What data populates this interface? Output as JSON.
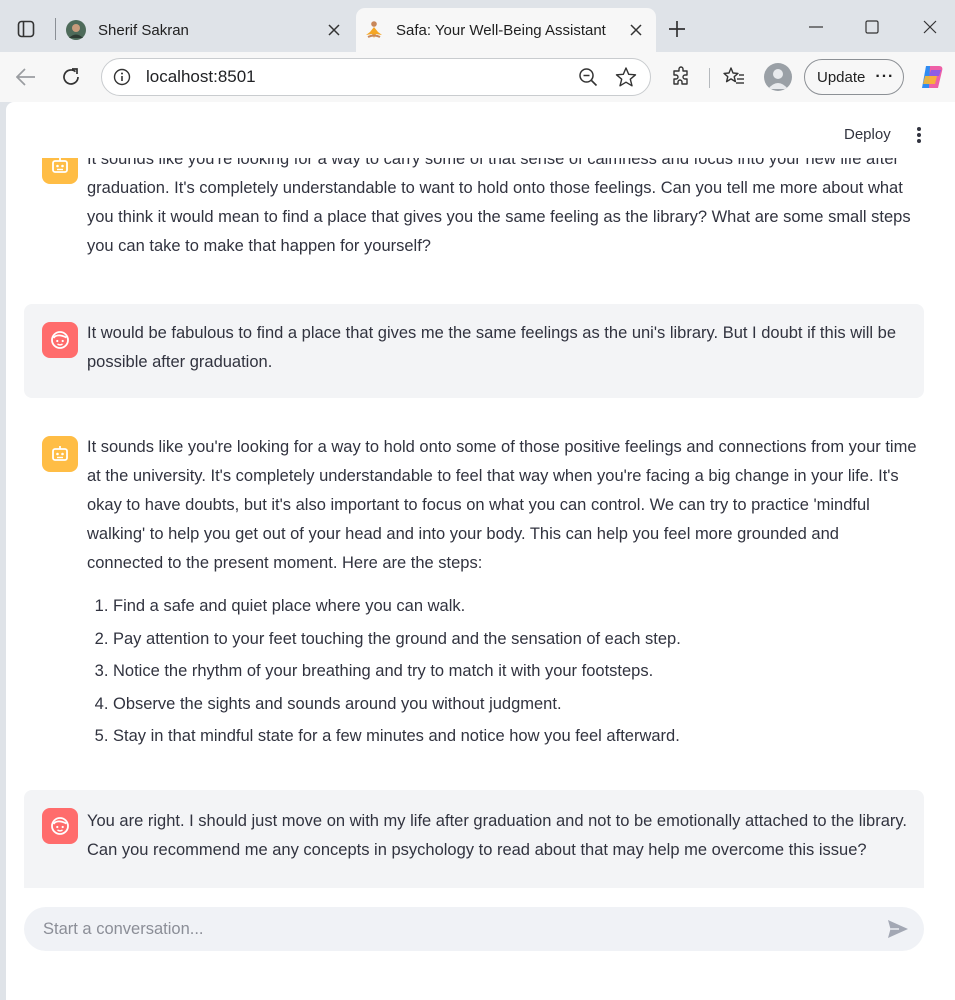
{
  "browser": {
    "tabs": [
      {
        "title": "Sherif Sakran"
      },
      {
        "title": "Safa: Your Well-Being Assistant"
      }
    ],
    "url": "localhost:8501",
    "update_label": "Update"
  },
  "app": {
    "deploy_label": "Deploy",
    "messages": [
      {
        "role": "assistant",
        "text": "It sounds like you're looking for a way to carry some of that sense of calmness and focus into your new life after graduation. It's completely understandable to want to hold onto those feelings. Can you tell me more about what you think it would mean to find a place that gives you the same feeling as the library? What are some small steps you can take to make that happen for yourself?"
      },
      {
        "role": "user",
        "text": "It would be fabulous to find a place that gives me the same feelings as the uni's library. But I doubt if this will be possible after graduation."
      },
      {
        "role": "assistant",
        "text": "It sounds like you're looking for a way to hold onto some of those positive feelings and connections from your time at the university. It's completely understandable to feel that way when you're facing a big change in your life. It's okay to have doubts, but it's also important to focus on what you can control. We can try to practice 'mindful walking' to help you get out of your head and into your body. This can help you feel more grounded and connected to the present moment. Here are the steps:",
        "steps": [
          "Find a safe and quiet place where you can walk.",
          "Pay attention to your feet touching the ground and the sensation of each step.",
          "Notice the rhythm of your breathing and try to match it with your footsteps.",
          "Observe the sights and sounds around you without judgment.",
          "Stay in that mindful state for a few minutes and notice how you feel afterward."
        ]
      },
      {
        "role": "user",
        "text": "You are right. I should just move on with my life after graduation and not to be emotionally attached to the library. Can you recommend me any concepts in psychology to read about that may help me overcome this issue?"
      }
    ],
    "input_placeholder": "Start a conversation..."
  },
  "colors": {
    "bot_avatar": "#ffbd45",
    "user_avatar": "#ff6c6c",
    "user_bubble": "#f3f4f6",
    "input_bg": "#f0f2f6",
    "text": "#31333f"
  }
}
